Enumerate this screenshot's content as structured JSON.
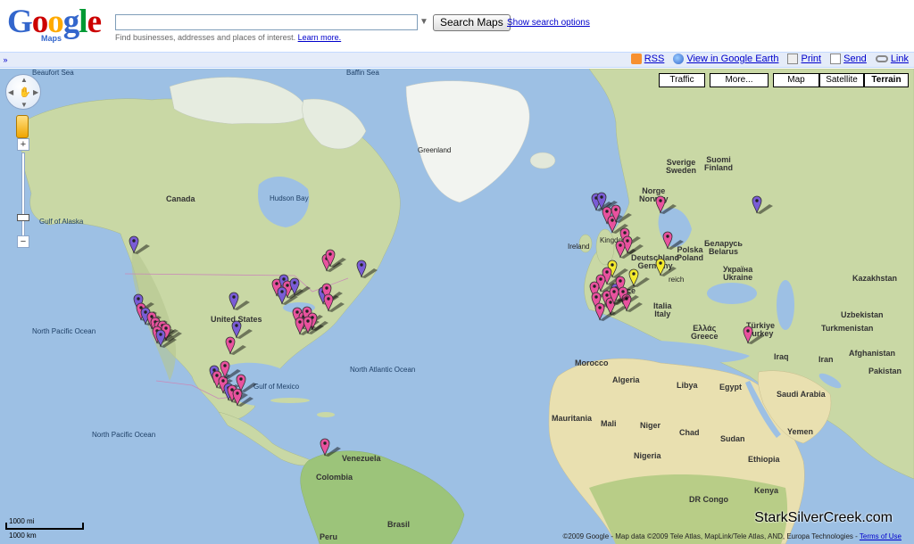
{
  "header": {
    "logo_letters": [
      "G",
      "o",
      "o",
      "g",
      "l",
      "e"
    ],
    "logo_colors": [
      "#3366cc",
      "#cc0000",
      "#ffaa00",
      "#3366cc",
      "#009933",
      "#cc0000"
    ],
    "logo_sub": "Maps",
    "search_value": "",
    "search_button": "Search Maps",
    "show_options": "Show search options",
    "hint_text": "Find businesses, addresses and places of interest.",
    "learn_more": "Learn more."
  },
  "toolbar": {
    "collapse": "»",
    "rss": "RSS",
    "earth": "View in Google Earth",
    "print": "Print",
    "send": "Send",
    "link": "Link",
    "icons": [
      "rss-icon",
      "earth-icon",
      "print-icon",
      "send-icon",
      "link-icon"
    ]
  },
  "map_controls": {
    "traffic": "Traffic",
    "more": "More...",
    "map": "Map",
    "satellite": "Satellite",
    "terrain": "Terrain",
    "active_type": "Terrain",
    "zoom_in": "+",
    "zoom_out": "−"
  },
  "labels": {
    "beaufort_sea": "Beaufort Sea",
    "baffin_sea": "Baffin Sea",
    "greenland": "Greenland",
    "canada": "Canada",
    "hudson_bay": "Hudson Bay",
    "gulf_alaska": "Gulf of Alaska",
    "united_states": "United States",
    "north_pacific": "North Pacific Ocean",
    "north_pacific_2": "North Pacific Ocean",
    "north_atlantic": "North Atlantic Ocean",
    "gulf_mexico": "Gulf of Mexico",
    "venezuela": "Venezuela",
    "colombia": "Colombia",
    "brasil": "Brasil",
    "peru": "Peru",
    "sverige": "Sverige",
    "sweden": "Sweden",
    "suomi": "Suomi",
    "finland": "Finland",
    "norge": "Norge",
    "norway": "Norway",
    "ireland": "Ireland",
    "kingdom": "Kingdom",
    "deutschland": "Deutschland",
    "germany": "Germany",
    "polska": "Polska",
    "poland": "Poland",
    "belarus_local": "Беларусь",
    "belarus": "Belarus",
    "ukraine_local": "Україна",
    "ukraine": "Ukraine",
    "kazakhstan": "Kazakhstan",
    "uzbekistan": "Uzbekistan",
    "turkmenistan": "Turkmenistan",
    "afghanistan": "Afghanistan",
    "pakistan": "Pakistan",
    "iran": "Iran",
    "iraq": "Iraq",
    "turkiye": "Türkiye",
    "turkey": "Turkey",
    "italia": "Italia",
    "italy": "Italy",
    "ellas": "Ελλάς",
    "greece": "Greece",
    "reich": "reich",
    "france": "rance",
    "morocco": "Morocco",
    "algeria": "Algeria",
    "libya": "Libya",
    "egypt": "Egypt",
    "saudi": "Saudi Arabia",
    "yemen": "Yemen",
    "mauritania": "Mauritania",
    "mali": "Mali",
    "niger": "Niger",
    "chad": "Chad",
    "sudan": "Sudan",
    "nigeria": "Nigeria",
    "ethiopia": "Ethiopia",
    "kenya": "Kenya",
    "drc": "DR Congo"
  },
  "scale": {
    "miles": "1000 mi",
    "km": "1000 km"
  },
  "copyright": {
    "text": "©2009 Google - Map data ©2009 Tele Atlas, MapLink/Tele Atlas, AND, Europa Technologies -",
    "terms": "Terms of Use"
  },
  "watermark": "StarkSilverCreek.com",
  "marker_colors": {
    "pink": "#e8529e",
    "purple": "#7a5cd6",
    "yellow": "#f3ea2e"
  }
}
